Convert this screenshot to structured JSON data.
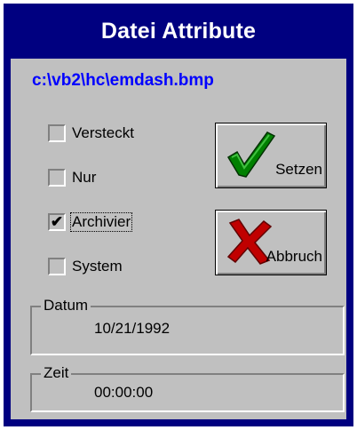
{
  "window": {
    "title": "Datei Attribute"
  },
  "file_path": "c:\\vb2\\hc\\emdash.bmp",
  "attributes": [
    {
      "label": "Versteckt",
      "checked": false
    },
    {
      "label": "Nur",
      "checked": false
    },
    {
      "label": "Archivier",
      "checked": true
    },
    {
      "label": "System",
      "checked": false
    }
  ],
  "buttons": {
    "set_label": "Setzen",
    "cancel_label": "Abbruch"
  },
  "date_group": {
    "legend": "Datum",
    "value": "10/21/1992"
  },
  "time_group": {
    "legend": "Zeit",
    "value": "00:00:00"
  },
  "colors": {
    "title_bar": "#000080",
    "face": "#c0c0c0",
    "path_text": "#0000ff",
    "check_green": "#008000",
    "cross_red": "#c00000"
  },
  "icons": {
    "set": "green-checkmark-icon",
    "cancel": "red-x-icon"
  }
}
